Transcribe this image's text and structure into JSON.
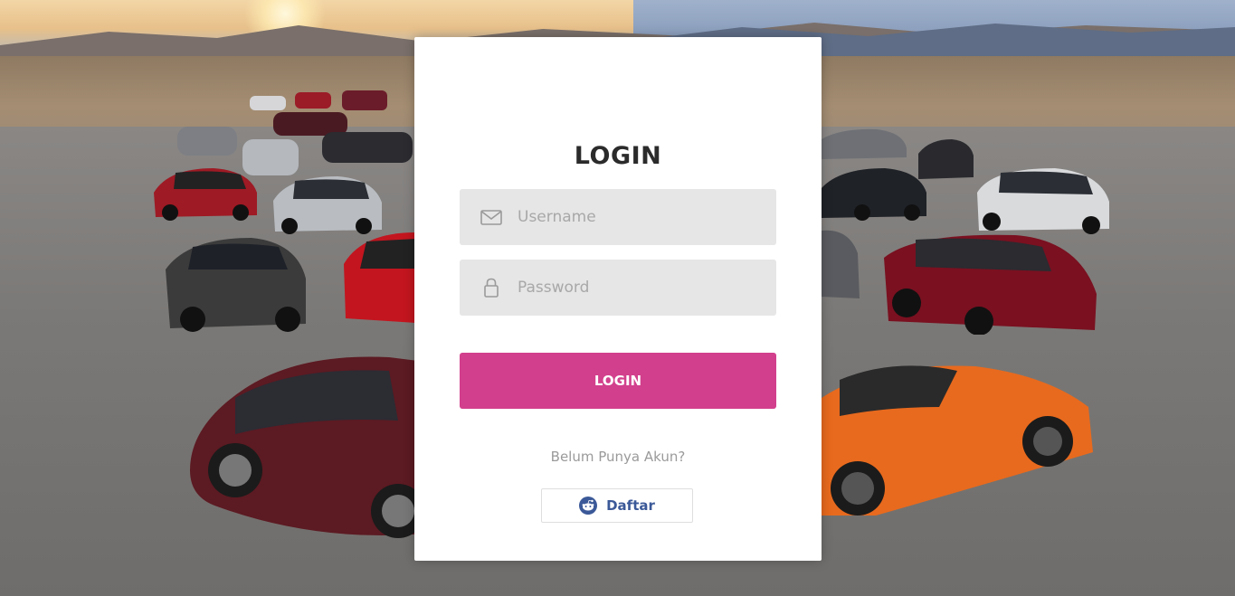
{
  "login_card": {
    "title": "LOGIN",
    "username": {
      "placeholder": "Username",
      "value": "",
      "icon": "envelope-icon"
    },
    "password": {
      "placeholder": "Password",
      "value": "",
      "icon": "lock-icon"
    },
    "login_button_label": "LOGIN",
    "signup_prompt": "Belum Punya Akun?",
    "register_button": {
      "label": "Daftar",
      "icon": "reddit-icon"
    }
  },
  "colors": {
    "primary_button": "#d23f8c",
    "register_text": "#3b5998",
    "field_background": "#e6e6e6"
  }
}
